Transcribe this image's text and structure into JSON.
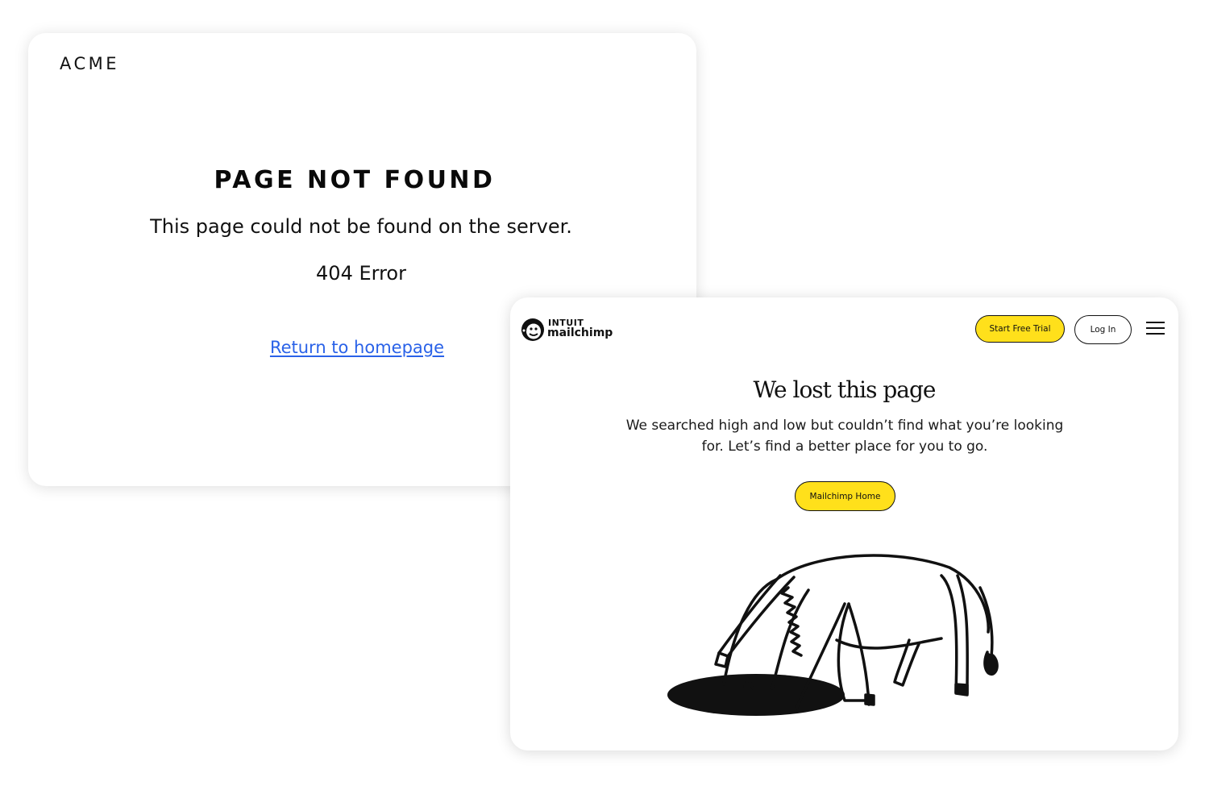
{
  "acme": {
    "logo": "ACME",
    "title": "PAGE NOT FOUND",
    "message": "This page could not be found on the server.",
    "error_code": "404 Error",
    "link_label": "Return to homepage",
    "link_color": "#2a62e8"
  },
  "mailchimp": {
    "brand": {
      "top": "INTUIT",
      "bottom": "mailchimp"
    },
    "nav": {
      "start_trial_label": "Start Free Trial",
      "login_label": "Log In",
      "menu_icon": "hamburger-menu-icon"
    },
    "title": "We lost this page",
    "text": "We searched high and low but couldn’t find what you’re looking for. Let’s find a better place for you to go.",
    "home_button_label": "Mailchimp Home",
    "illustration": "horse-in-hole-illustration",
    "accent_color": "#ffe01b"
  }
}
